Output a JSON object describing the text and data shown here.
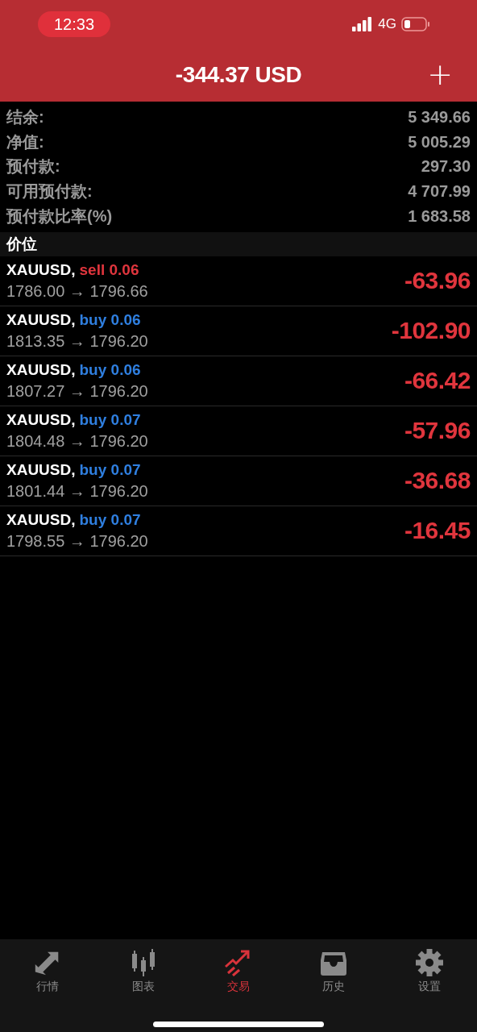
{
  "status_bar": {
    "time": "12:33",
    "network": "4G"
  },
  "header": {
    "title": "-344.37 USD",
    "action": "+"
  },
  "summary": [
    {
      "label": "结余:",
      "value": "5 349.66"
    },
    {
      "label": "净值:",
      "value": "5 005.29"
    },
    {
      "label": "预付款:",
      "value": "297.30"
    },
    {
      "label": "可用预付款:",
      "value": "4 707.99"
    },
    {
      "label": "预付款比率(%)",
      "value": "1 683.58"
    }
  ],
  "section": {
    "title": "价位"
  },
  "positions": [
    {
      "symbol": "XAUUSD,",
      "kind": "sell",
      "order": "sell 0.06",
      "prices": "1786.00 → 1796.66",
      "profit": "-63.96"
    },
    {
      "symbol": "XAUUSD,",
      "kind": "buy",
      "order": "buy 0.06",
      "prices": "1813.35 → 1796.20",
      "profit": "-102.90"
    },
    {
      "symbol": "XAUUSD,",
      "kind": "buy",
      "order": "buy 0.06",
      "prices": "1807.27 → 1796.20",
      "profit": "-66.42"
    },
    {
      "symbol": "XAUUSD,",
      "kind": "buy",
      "order": "buy 0.07",
      "prices": "1804.48 → 1796.20",
      "profit": "-57.96"
    },
    {
      "symbol": "XAUUSD,",
      "kind": "buy",
      "order": "buy 0.07",
      "prices": "1801.44 → 1796.20",
      "profit": "-36.68"
    },
    {
      "symbol": "XAUUSD,",
      "kind": "buy",
      "order": "buy 0.07",
      "prices": "1798.55 → 1796.20",
      "profit": "-16.45"
    }
  ],
  "tabs": [
    {
      "label": "行情",
      "kind": "quotes",
      "selected": false
    },
    {
      "label": "图表",
      "kind": "chart",
      "selected": false
    },
    {
      "label": "交易",
      "kind": "trade",
      "selected": true
    },
    {
      "label": "历史",
      "kind": "history",
      "selected": false
    },
    {
      "label": "设置",
      "kind": "settings",
      "selected": false
    }
  ]
}
